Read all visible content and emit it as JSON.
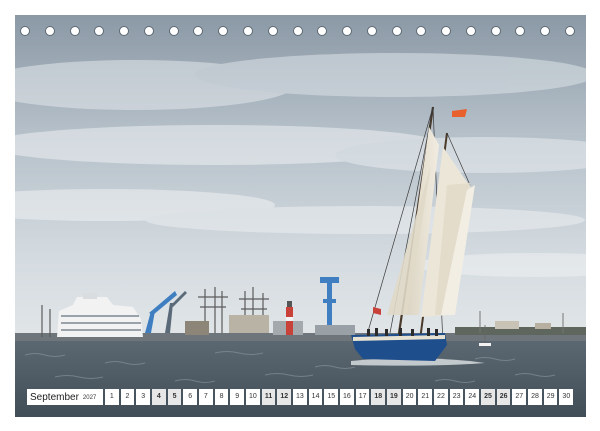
{
  "calendar": {
    "month": "September",
    "year": "2027",
    "days": [
      "1",
      "2",
      "3",
      "4",
      "5",
      "6",
      "7",
      "8",
      "9",
      "10",
      "11",
      "12",
      "13",
      "14",
      "15",
      "16",
      "17",
      "18",
      "19",
      "20",
      "21",
      "22",
      "23",
      "24",
      "25",
      "26",
      "27",
      "28",
      "29",
      "30"
    ],
    "weekend_days": [
      "4",
      "5",
      "11",
      "12",
      "18",
      "19",
      "25",
      "26"
    ]
  },
  "binding": {
    "hole_count": 23
  },
  "photo": {
    "sky_top": "#8b99a6",
    "sky_mid": "#c9d2da",
    "sky_horizon": "#dfe4e6",
    "water": "#4f5c66",
    "hull": "#1f4e8c",
    "sail": "#e7e1d2",
    "flag": "#e8602c",
    "ship": "#f2f2f2",
    "crane": "#3f7fc1"
  }
}
